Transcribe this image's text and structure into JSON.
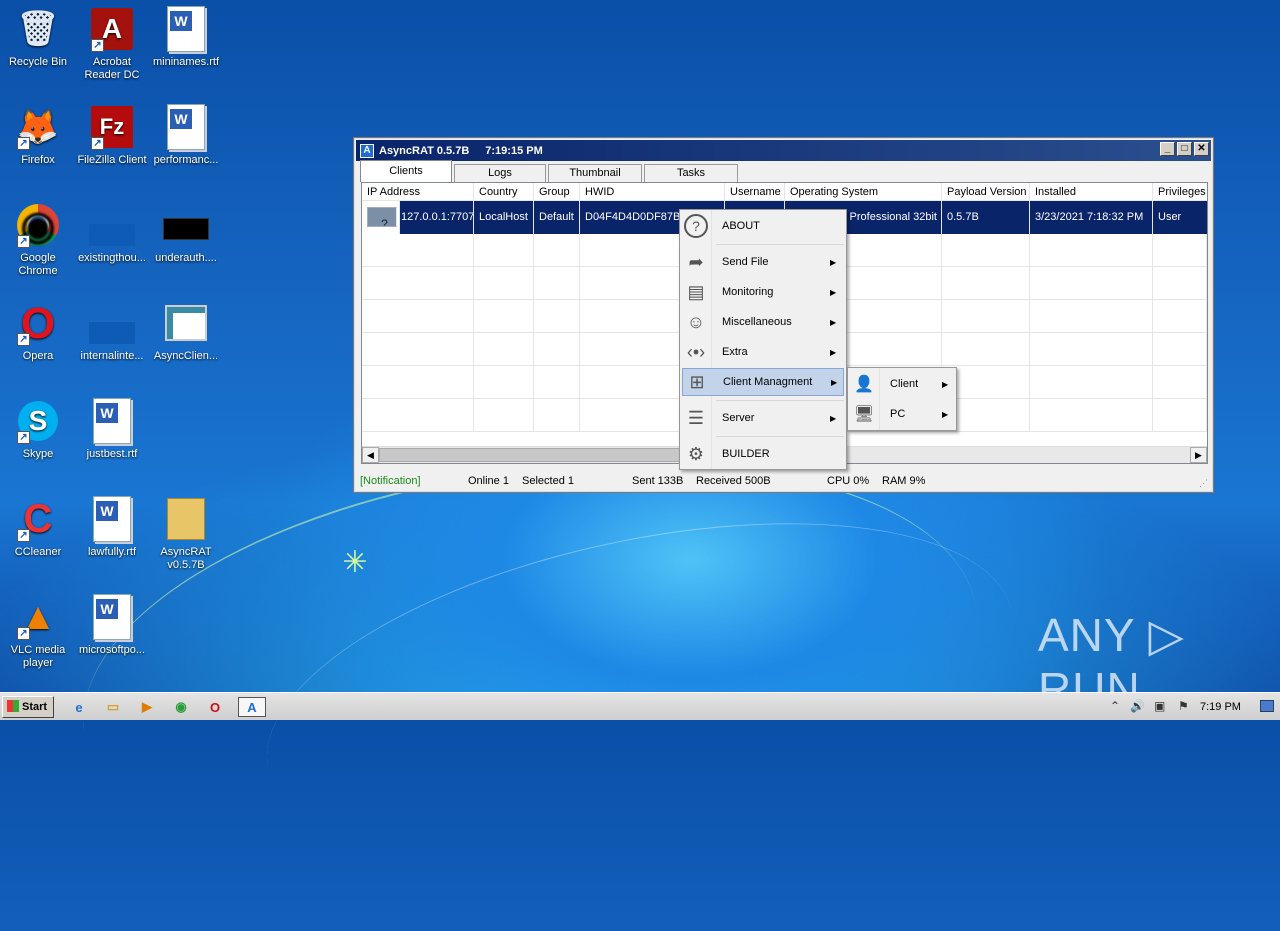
{
  "desktop": {
    "icons": [
      {
        "label": "Recycle Bin",
        "glyph": "🗑",
        "icon": "recycle-bin-icon"
      },
      {
        "label": "Acrobat Reader DC",
        "glyph": "A",
        "icon": "acrobat-icon"
      },
      {
        "label": "mininames.rtf",
        "glyph": "W",
        "icon": "word-doc-icon"
      },
      {
        "label": "Firefox",
        "glyph": "🦊",
        "icon": "firefox-icon"
      },
      {
        "label": "FileZilla Client",
        "glyph": "Fz",
        "icon": "filezilla-icon"
      },
      {
        "label": "performanc...",
        "glyph": "W",
        "icon": "word-doc-icon"
      },
      {
        "label": "Google Chrome",
        "glyph": "◉",
        "icon": "chrome-icon"
      },
      {
        "label": "existingthou...",
        "glyph": "",
        "icon": "blank-file-icon"
      },
      {
        "label": "underauth....",
        "glyph": "",
        "icon": "black-file-icon"
      },
      {
        "label": "Opera",
        "glyph": "O",
        "icon": "opera-icon"
      },
      {
        "label": "internalinte...",
        "glyph": "",
        "icon": "blank-file-icon"
      },
      {
        "label": "AsyncClien...",
        "glyph": "",
        "icon": "image-file-icon"
      },
      {
        "label": "Skype",
        "glyph": "S",
        "icon": "skype-icon"
      },
      {
        "label": "justbest.rtf",
        "glyph": "W",
        "icon": "word-doc-icon"
      },
      {
        "label": "CCleaner",
        "glyph": "C",
        "icon": "ccleaner-icon"
      },
      {
        "label": "lawfully.rtf",
        "glyph": "W",
        "icon": "word-doc-icon"
      },
      {
        "label": "AsyncRAT v0.5.7B",
        "glyph": "",
        "icon": "folder-icon"
      },
      {
        "label": "VLC media player",
        "glyph": "▲",
        "icon": "vlc-icon"
      },
      {
        "label": "microsoftpo...",
        "glyph": "W",
        "icon": "word-doc-icon"
      }
    ]
  },
  "window": {
    "title": "AsyncRAT 0.5.7B",
    "time": "7:19:15 PM",
    "logo_glyph": "A",
    "min_glyph": "_",
    "max_glyph": "□",
    "close_glyph": "✕",
    "tabs": [
      "Clients",
      "Logs",
      "Thumbnail",
      "Tasks"
    ],
    "columns": [
      "IP Address",
      "Country",
      "Group",
      "HWID",
      "Username",
      "Operating System",
      "Payload Version",
      "Installed",
      "Privileges"
    ],
    "row": {
      "ip": "127.0.0.1:7707",
      "country": "LocalHost",
      "group": "Default",
      "hwid": "D04F4D4D0DF87B",
      "username": "",
      "os": "Professional 32bit",
      "payload": "0.5.7B",
      "installed": "3/23/2021 7:18:32 PM",
      "privileges": "User",
      "thumb_glyph": "?"
    },
    "scroll_left": "◀",
    "scroll_right": "▶",
    "status": {
      "notification": "[Notification]",
      "online": "Online 1",
      "selected": "Selected 1",
      "sent": "Sent 133B",
      "received": "Received 500B",
      "cpu": "CPU 0%",
      "ram": "RAM 9%"
    },
    "grip_glyph": "⋰"
  },
  "context_menu": {
    "items": [
      {
        "label": "ABOUT",
        "glyph": "?",
        "icon": "about-icon"
      },
      {
        "label": "Send File",
        "glyph": "➦",
        "icon": "send-file-icon"
      },
      {
        "label": "Monitoring",
        "glyph": "▤",
        "icon": "monitoring-icon"
      },
      {
        "label": "Miscellaneous",
        "glyph": "☺",
        "icon": "miscellaneous-icon"
      },
      {
        "label": "Extra",
        "glyph": "‹•›",
        "icon": "extra-icon"
      },
      {
        "label": "Client Managment",
        "glyph": "⊞",
        "icon": "client-management-icon"
      },
      {
        "label": "Server",
        "glyph": "☰",
        "icon": "server-icon"
      },
      {
        "label": "BUILDER",
        "glyph": "⚙",
        "icon": "builder-icon"
      }
    ],
    "arrow": "▶"
  },
  "submenu": {
    "items": [
      {
        "label": "Client",
        "glyph": "👤",
        "icon": "client-user-icon"
      },
      {
        "label": "PC",
        "glyph": "🖥",
        "icon": "pc-icon"
      }
    ]
  },
  "taskbar": {
    "start": "Start",
    "apps": [
      {
        "glyph": "e",
        "icon": "ie-icon",
        "color": "#1e73d2"
      },
      {
        "glyph": "▭",
        "icon": "explorer-icon",
        "color": "#d8a030"
      },
      {
        "glyph": "▶",
        "icon": "media-player-icon",
        "color": "#e07b00"
      },
      {
        "glyph": "◉",
        "icon": "chrome-taskbar-icon",
        "color": "#2a9d3a"
      },
      {
        "glyph": "O",
        "icon": "opera-taskbar-icon",
        "color": "#cc0f16"
      },
      {
        "glyph": "A",
        "icon": "asyncrat-taskbar-icon",
        "color": "#1c6fd0"
      }
    ],
    "tray": [
      "⌃",
      "🔊",
      "▣",
      "⚑"
    ],
    "clock": "7:19 PM"
  },
  "watermark": "ANY ▷ RUN"
}
